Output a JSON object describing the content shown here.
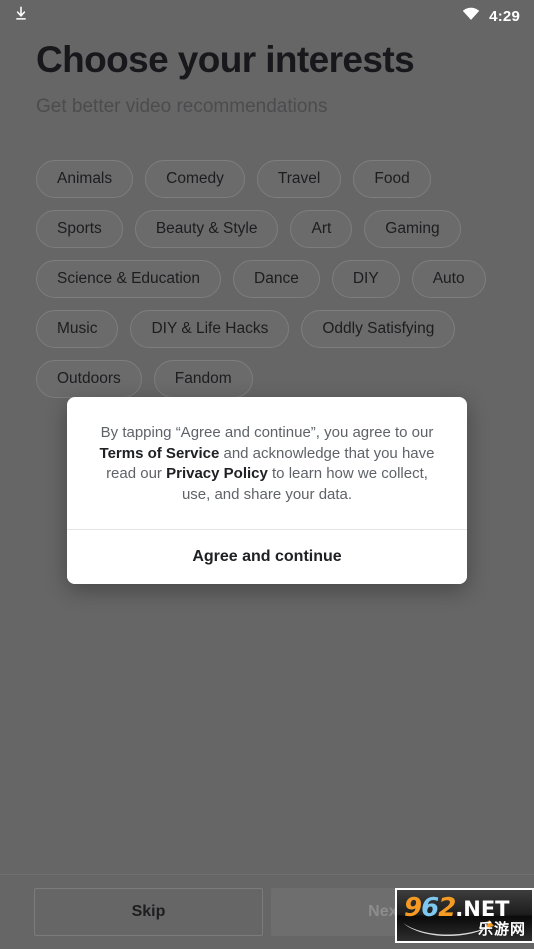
{
  "status_bar": {
    "download_icon": "download-icon",
    "wifi_icon": "wifi-icon",
    "time": "4:29"
  },
  "header": {
    "title": "Choose your interests",
    "subtitle": "Get better video recommendations"
  },
  "interests": {
    "chips": [
      {
        "label": "Animals",
        "selected": false
      },
      {
        "label": "Comedy",
        "selected": false
      },
      {
        "label": "Travel",
        "selected": false
      },
      {
        "label": "Food",
        "selected": false
      },
      {
        "label": "Sports",
        "selected": false
      },
      {
        "label": "Beauty & Style",
        "selected": false
      },
      {
        "label": "Art",
        "selected": false
      },
      {
        "label": "Gaming",
        "selected": false
      },
      {
        "label": "Science & Education",
        "selected": false
      },
      {
        "label": "Dance",
        "selected": false
      },
      {
        "label": "DIY",
        "selected": false
      },
      {
        "label": "Auto",
        "selected": false
      },
      {
        "label": "Music",
        "selected": false
      },
      {
        "label": "DIY & Life Hacks",
        "selected": false
      },
      {
        "label": "Oddly Satisfying",
        "selected": false
      },
      {
        "label": "Outdoors",
        "selected": false
      },
      {
        "label": "Fandom",
        "selected": false
      }
    ]
  },
  "bottom_bar": {
    "skip_label": "Skip",
    "next_label": "Next",
    "next_enabled": false
  },
  "dialog": {
    "message_part_1": "By tapping “Agree and continue”, you agree to our ",
    "terms_link": "Terms of Service",
    "message_part_2": " and acknowledge that you have read our ",
    "privacy_link": "Privacy Policy",
    "message_part_3": " to learn how we collect, use, and share your data.",
    "agree_label": "Agree and continue"
  },
  "watermark": {
    "digit_9": "9",
    "digit_6": "6",
    "digit_2": "2",
    "tld": ".NET",
    "subtitle": "乐游网"
  },
  "colors": {
    "scrim": "#666666",
    "title_text": "#18181c",
    "subtitle_text": "#4c4c4e",
    "chip_border": "#7d7d7d",
    "chip_fill": "#6b6b6b",
    "dialog_bg": "#ffffff",
    "dialog_text": "#5f6368",
    "dialog_link": "#202124",
    "next_disabled_text": "#8d8d8d"
  }
}
